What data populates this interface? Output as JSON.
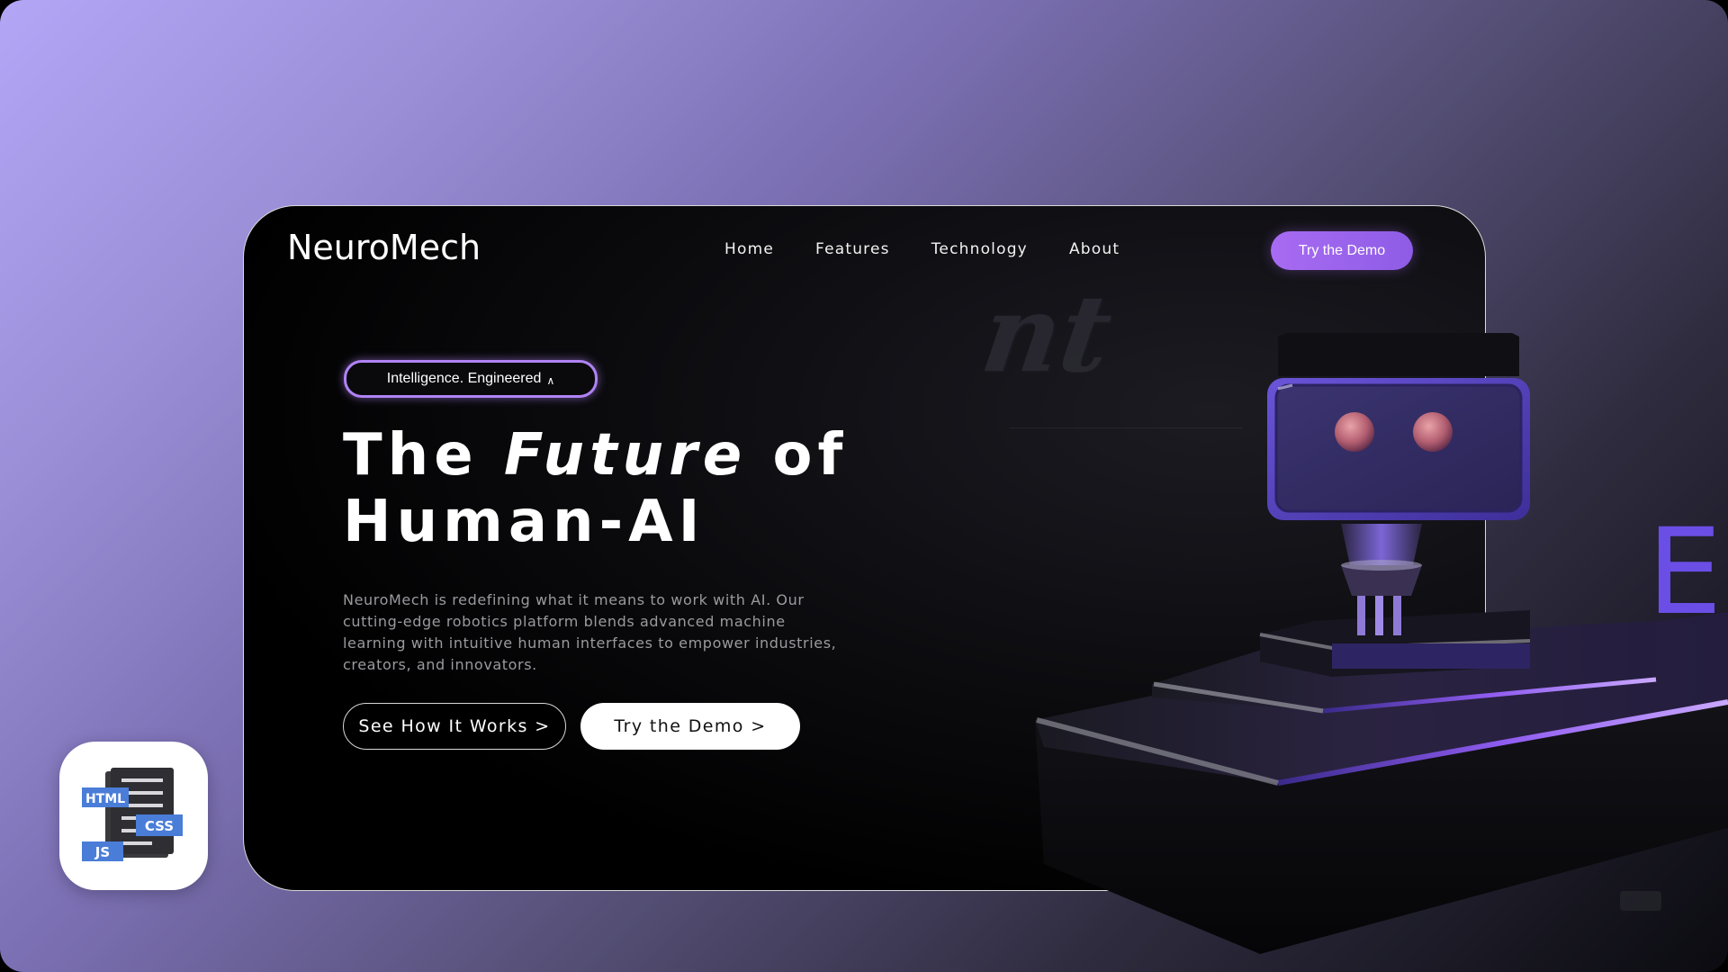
{
  "brand": {
    "name": "NeuroMech"
  },
  "nav": {
    "items": [
      "Home",
      "Features",
      "Technology",
      "About"
    ],
    "cta_label": "Try the Demo"
  },
  "hero": {
    "badge": "Intelligence. Engineered",
    "headline_part1": "The ",
    "headline_emphasis": "Future",
    "headline_part2": " of",
    "headline_line2": "Human-AI",
    "description": "NeuroMech is redefining what it means to work with AI. Our cutting-edge robotics platform blends advanced machine learning with intuitive human interfaces to empower industries, creators, and innovators.",
    "primary_button": "See How It Works >",
    "secondary_button": "Try the Demo >"
  },
  "decor": {
    "ghost_text": "nt",
    "big_letter": "E"
  },
  "app_icon": {
    "labels": [
      "HTML",
      "CSS",
      "JS"
    ]
  },
  "colors": {
    "accent": "#a86bf2",
    "background_start": "#b3a6f6",
    "background_end": "#0b0b10",
    "robot_purple": "#5a3fc6"
  }
}
